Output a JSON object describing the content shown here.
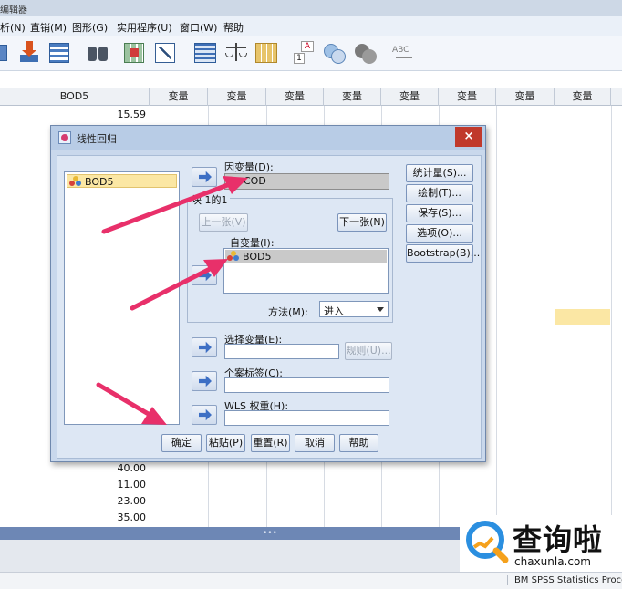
{
  "window": {
    "title": "编辑器"
  },
  "menubar": {
    "items": [
      "析(N)",
      "直销(M)",
      "图形(G)",
      "实用程序(U)",
      "窗口(W)",
      "帮助"
    ]
  },
  "grid": {
    "var_col": "BOD5",
    "other_cols": [
      "变量",
      "变量",
      "变量",
      "变量",
      "变量",
      "变量",
      "变量",
      "变量"
    ],
    "top_values": [
      "15.59"
    ],
    "bottom_values": [
      "40.00",
      "11.00",
      "23.00",
      "35.00"
    ]
  },
  "dialog": {
    "title": "线性回归",
    "close": "×",
    "source_vars": [
      "BOD5"
    ],
    "dependent": {
      "label": "因变量(D):",
      "value": "COD"
    },
    "block": {
      "label": "块 1的1",
      "prev": "上一张(V)",
      "next": "下一张(N)"
    },
    "independent": {
      "label": "自变量(I):",
      "items": [
        "BOD5"
      ]
    },
    "method": {
      "label": "方法(M):",
      "value": "进入"
    },
    "selection": {
      "label": "选择变量(E):",
      "rule": "规则(U)..."
    },
    "case_labels": {
      "label": "个案标签(C):"
    },
    "wls": {
      "label": "WLS 权重(H):"
    },
    "side_buttons": [
      "统计量(S)...",
      "绘制(T)...",
      "保存(S)...",
      "选项(O)...",
      "Bootstrap(B)..."
    ],
    "bottom_buttons": [
      "确定",
      "粘贴(P)",
      "重置(R)",
      "取消",
      "帮助"
    ]
  },
  "statusbar": {
    "text": "IBM SPSS Statistics Proces"
  },
  "watermark": {
    "cn": "查询啦",
    "en": "chaxunla.com"
  },
  "colors": {
    "arrow": "#e8306a",
    "highlight": "#fbe7a4",
    "dialog_bg": "#dde7f4",
    "close": "#c0392b"
  }
}
